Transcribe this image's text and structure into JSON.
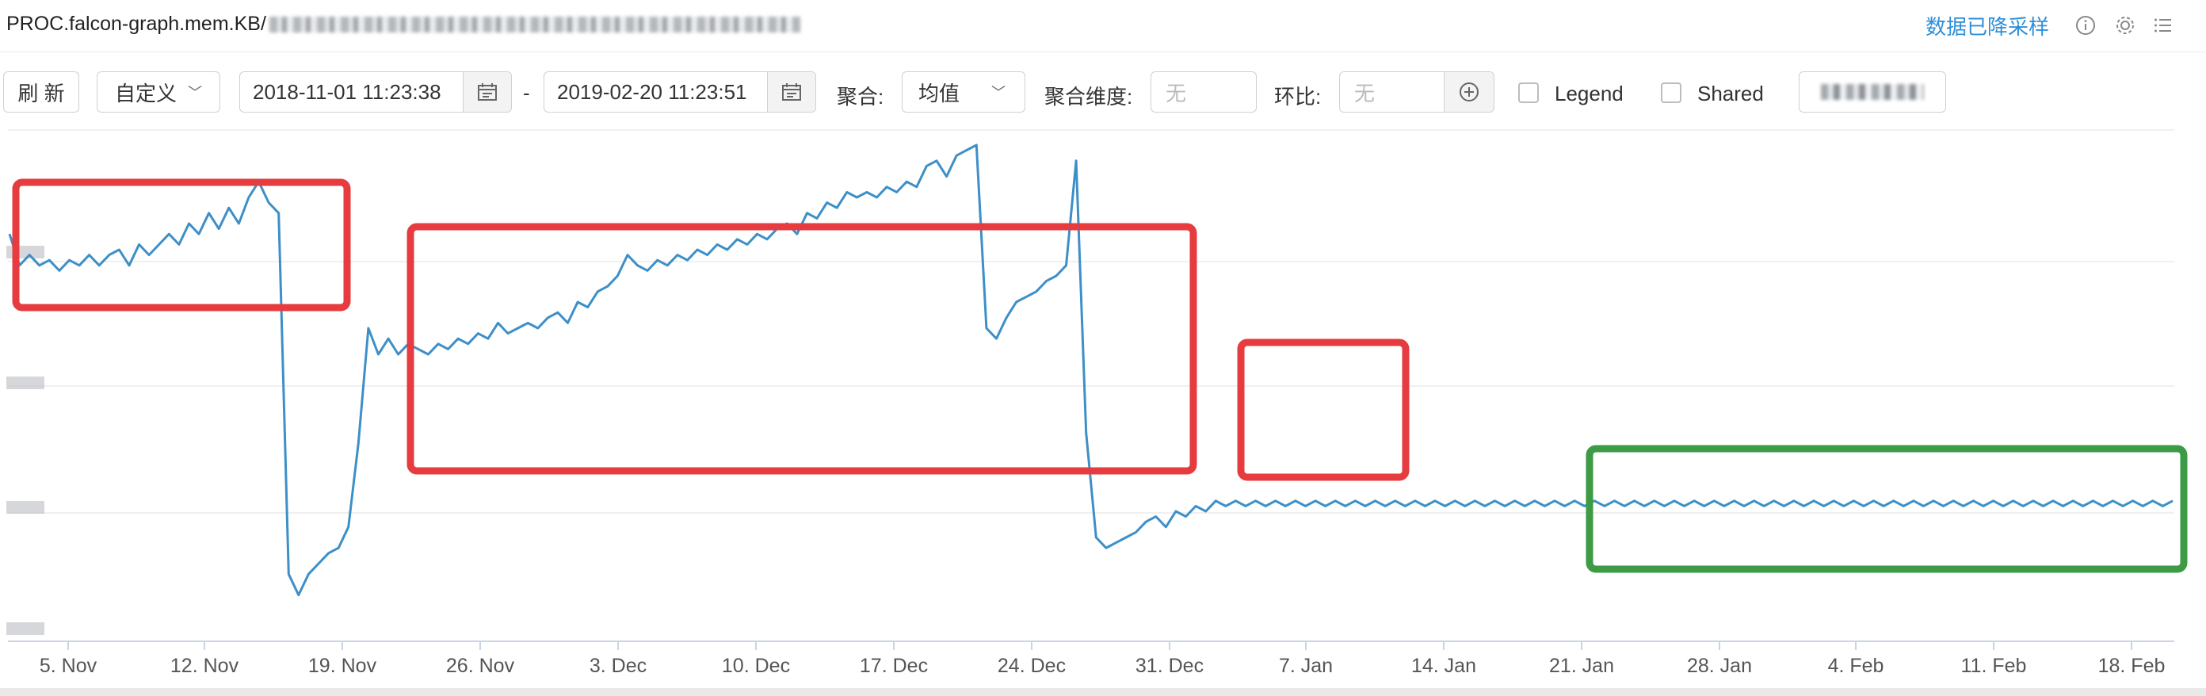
{
  "header": {
    "title": "PROC.falcon-graph.mem.KB/",
    "sampled_label": "数据已降采样",
    "icons": [
      "info-icon",
      "gear-icon",
      "list-icon"
    ]
  },
  "toolbar": {
    "refresh_label": "刷 新",
    "range_mode": "自定义",
    "start_time": "2018-11-01 11:23:38",
    "separator": "-",
    "end_time": "2019-02-20 11:23:51",
    "aggregate_label": "聚合:",
    "aggregate_value": "均值",
    "agg_dim_label": "聚合维度:",
    "agg_dim_placeholder": "无",
    "compare_label": "环比:",
    "compare_placeholder": "无",
    "legend_label": "Legend",
    "shared_label": "Shared",
    "legend_checked": false,
    "shared_checked": false
  },
  "chart_data": {
    "type": "line",
    "x_axis": "date",
    "xlim": [
      "2018-11-01",
      "2019-02-20"
    ],
    "x_tick_labels": [
      "5. Nov",
      "12. Nov",
      "19. Nov",
      "26. Nov",
      "3. Dec",
      "10. Dec",
      "17. Dec",
      "24. Dec",
      "31. Dec",
      "7. Jan",
      "14. Jan",
      "21. Jan",
      "28. Jan",
      "4. Feb",
      "11. Feb",
      "18. Feb"
    ],
    "y_tick_labels_visible": false,
    "y_relative_note_hidden": true,
    "grid": "horizontal",
    "legend": "none",
    "series_color": "#3d8fc8",
    "series": [
      {
        "values": [
          [
            0,
            0.78
          ],
          [
            1,
            0.72
          ],
          [
            2,
            0.74
          ],
          [
            3,
            0.72
          ],
          [
            4,
            0.73
          ],
          [
            5,
            0.71
          ],
          [
            6,
            0.73
          ],
          [
            7,
            0.72
          ],
          [
            8,
            0.74
          ],
          [
            9,
            0.72
          ],
          [
            10,
            0.74
          ],
          [
            11,
            0.75
          ],
          [
            12,
            0.72
          ],
          [
            13,
            0.76
          ],
          [
            14,
            0.74
          ],
          [
            15,
            0.76
          ],
          [
            16,
            0.78
          ],
          [
            17,
            0.76
          ],
          [
            18,
            0.8
          ],
          [
            19,
            0.78
          ],
          [
            20,
            0.82
          ],
          [
            21,
            0.79
          ],
          [
            22,
            0.83
          ],
          [
            23,
            0.8
          ],
          [
            24,
            0.85
          ],
          [
            25,
            0.88
          ],
          [
            26,
            0.84
          ],
          [
            27,
            0.82
          ],
          [
            28,
            0.13
          ],
          [
            29,
            0.09
          ],
          [
            30,
            0.13
          ],
          [
            31,
            0.15
          ],
          [
            32,
            0.17
          ],
          [
            33,
            0.18
          ],
          [
            34,
            0.22
          ],
          [
            35,
            0.38
          ],
          [
            36,
            0.6
          ],
          [
            37,
            0.55
          ],
          [
            38,
            0.58
          ],
          [
            39,
            0.55
          ],
          [
            40,
            0.57
          ],
          [
            41,
            0.56
          ],
          [
            42,
            0.55
          ],
          [
            43,
            0.57
          ],
          [
            44,
            0.56
          ],
          [
            45,
            0.58
          ],
          [
            46,
            0.57
          ],
          [
            47,
            0.59
          ],
          [
            48,
            0.58
          ],
          [
            49,
            0.61
          ],
          [
            50,
            0.59
          ],
          [
            51,
            0.6
          ],
          [
            52,
            0.61
          ],
          [
            53,
            0.6
          ],
          [
            54,
            0.62
          ],
          [
            55,
            0.63
          ],
          [
            56,
            0.61
          ],
          [
            57,
            0.65
          ],
          [
            58,
            0.64
          ],
          [
            59,
            0.67
          ],
          [
            60,
            0.68
          ],
          [
            61,
            0.7
          ],
          [
            62,
            0.74
          ],
          [
            63,
            0.72
          ],
          [
            64,
            0.71
          ],
          [
            65,
            0.73
          ],
          [
            66,
            0.72
          ],
          [
            67,
            0.74
          ],
          [
            68,
            0.73
          ],
          [
            69,
            0.75
          ],
          [
            70,
            0.74
          ],
          [
            71,
            0.76
          ],
          [
            72,
            0.75
          ],
          [
            73,
            0.77
          ],
          [
            74,
            0.76
          ],
          [
            75,
            0.78
          ],
          [
            76,
            0.77
          ],
          [
            77,
            0.79
          ],
          [
            78,
            0.8
          ],
          [
            79,
            0.78
          ],
          [
            80,
            0.82
          ],
          [
            81,
            0.81
          ],
          [
            82,
            0.84
          ],
          [
            83,
            0.83
          ],
          [
            84,
            0.86
          ],
          [
            85,
            0.85
          ],
          [
            86,
            0.86
          ],
          [
            87,
            0.85
          ],
          [
            88,
            0.87
          ],
          [
            89,
            0.86
          ],
          [
            90,
            0.88
          ],
          [
            91,
            0.87
          ],
          [
            92,
            0.91
          ],
          [
            93,
            0.92
          ],
          [
            94,
            0.89
          ],
          [
            95,
            0.93
          ],
          [
            96,
            0.94
          ],
          [
            97,
            0.95
          ],
          [
            98,
            0.6
          ],
          [
            99,
            0.58
          ],
          [
            100,
            0.62
          ],
          [
            101,
            0.65
          ],
          [
            102,
            0.66
          ],
          [
            103,
            0.67
          ],
          [
            104,
            0.69
          ],
          [
            105,
            0.7
          ],
          [
            106,
            0.72
          ],
          [
            107,
            0.92
          ],
          [
            108,
            0.4
          ],
          [
            109,
            0.2
          ],
          [
            110,
            0.18
          ],
          [
            111,
            0.19
          ],
          [
            112,
            0.2
          ],
          [
            113,
            0.21
          ],
          [
            114,
            0.23
          ],
          [
            115,
            0.24
          ],
          [
            116,
            0.22
          ],
          [
            117,
            0.25
          ],
          [
            118,
            0.24
          ],
          [
            119,
            0.26
          ],
          [
            120,
            0.25
          ],
          [
            121,
            0.27
          ],
          [
            122,
            0.26
          ],
          [
            123,
            0.27
          ],
          [
            124,
            0.26
          ],
          [
            125,
            0.27
          ],
          [
            126,
            0.26
          ],
          [
            127,
            0.27
          ],
          [
            128,
            0.26
          ],
          [
            129,
            0.27
          ],
          [
            130,
            0.26
          ],
          [
            131,
            0.27
          ],
          [
            132,
            0.26
          ],
          [
            133,
            0.27
          ],
          [
            134,
            0.26
          ],
          [
            135,
            0.27
          ],
          [
            136,
            0.26
          ],
          [
            137,
            0.27
          ],
          [
            138,
            0.26
          ],
          [
            139,
            0.27
          ],
          [
            140,
            0.26
          ],
          [
            141,
            0.27
          ],
          [
            142,
            0.26
          ],
          [
            143,
            0.27
          ],
          [
            144,
            0.26
          ],
          [
            145,
            0.27
          ],
          [
            146,
            0.26
          ],
          [
            147,
            0.27
          ],
          [
            148,
            0.26
          ],
          [
            149,
            0.27
          ],
          [
            150,
            0.26
          ],
          [
            151,
            0.27
          ],
          [
            152,
            0.26
          ],
          [
            153,
            0.27
          ],
          [
            154,
            0.26
          ],
          [
            155,
            0.27
          ],
          [
            156,
            0.26
          ],
          [
            157,
            0.27
          ],
          [
            158,
            0.26
          ],
          [
            159,
            0.27
          ],
          [
            160,
            0.26
          ],
          [
            161,
            0.27
          ],
          [
            162,
            0.26
          ],
          [
            163,
            0.27
          ],
          [
            164,
            0.26
          ],
          [
            165,
            0.27
          ],
          [
            166,
            0.26
          ],
          [
            167,
            0.27
          ],
          [
            168,
            0.26
          ],
          [
            169,
            0.27
          ],
          [
            170,
            0.26
          ],
          [
            171,
            0.27
          ],
          [
            172,
            0.26
          ],
          [
            173,
            0.27
          ],
          [
            174,
            0.26
          ],
          [
            175,
            0.27
          ],
          [
            176,
            0.26
          ],
          [
            177,
            0.27
          ],
          [
            178,
            0.26
          ],
          [
            179,
            0.27
          ],
          [
            180,
            0.26
          ],
          [
            181,
            0.27
          ],
          [
            182,
            0.26
          ],
          [
            183,
            0.27
          ],
          [
            184,
            0.26
          ],
          [
            185,
            0.27
          ],
          [
            186,
            0.26
          ],
          [
            187,
            0.27
          ],
          [
            188,
            0.26
          ],
          [
            189,
            0.27
          ],
          [
            190,
            0.26
          ],
          [
            191,
            0.27
          ],
          [
            192,
            0.26
          ],
          [
            193,
            0.27
          ],
          [
            194,
            0.26
          ],
          [
            195,
            0.27
          ],
          [
            196,
            0.26
          ],
          [
            197,
            0.27
          ],
          [
            198,
            0.26
          ],
          [
            199,
            0.27
          ],
          [
            200,
            0.26
          ],
          [
            201,
            0.27
          ],
          [
            202,
            0.26
          ],
          [
            203,
            0.27
          ],
          [
            204,
            0.26
          ],
          [
            205,
            0.27
          ],
          [
            206,
            0.26
          ],
          [
            207,
            0.27
          ],
          [
            208,
            0.26
          ],
          [
            209,
            0.27
          ],
          [
            210,
            0.26
          ],
          [
            211,
            0.27
          ],
          [
            212,
            0.26
          ],
          [
            213,
            0.27
          ],
          [
            214,
            0.26
          ],
          [
            215,
            0.27
          ],
          [
            216,
            0.26
          ],
          [
            217,
            0.27
          ]
        ]
      }
    ],
    "annotations": [
      {
        "type": "rect",
        "color": "#e63c3f",
        "label": ""
      },
      {
        "type": "rect",
        "color": "#e63c3f",
        "label": ""
      },
      {
        "type": "rect",
        "color": "#e63c3f",
        "label": ""
      },
      {
        "type": "rect",
        "color": "#3d9a45",
        "label": ""
      }
    ]
  }
}
